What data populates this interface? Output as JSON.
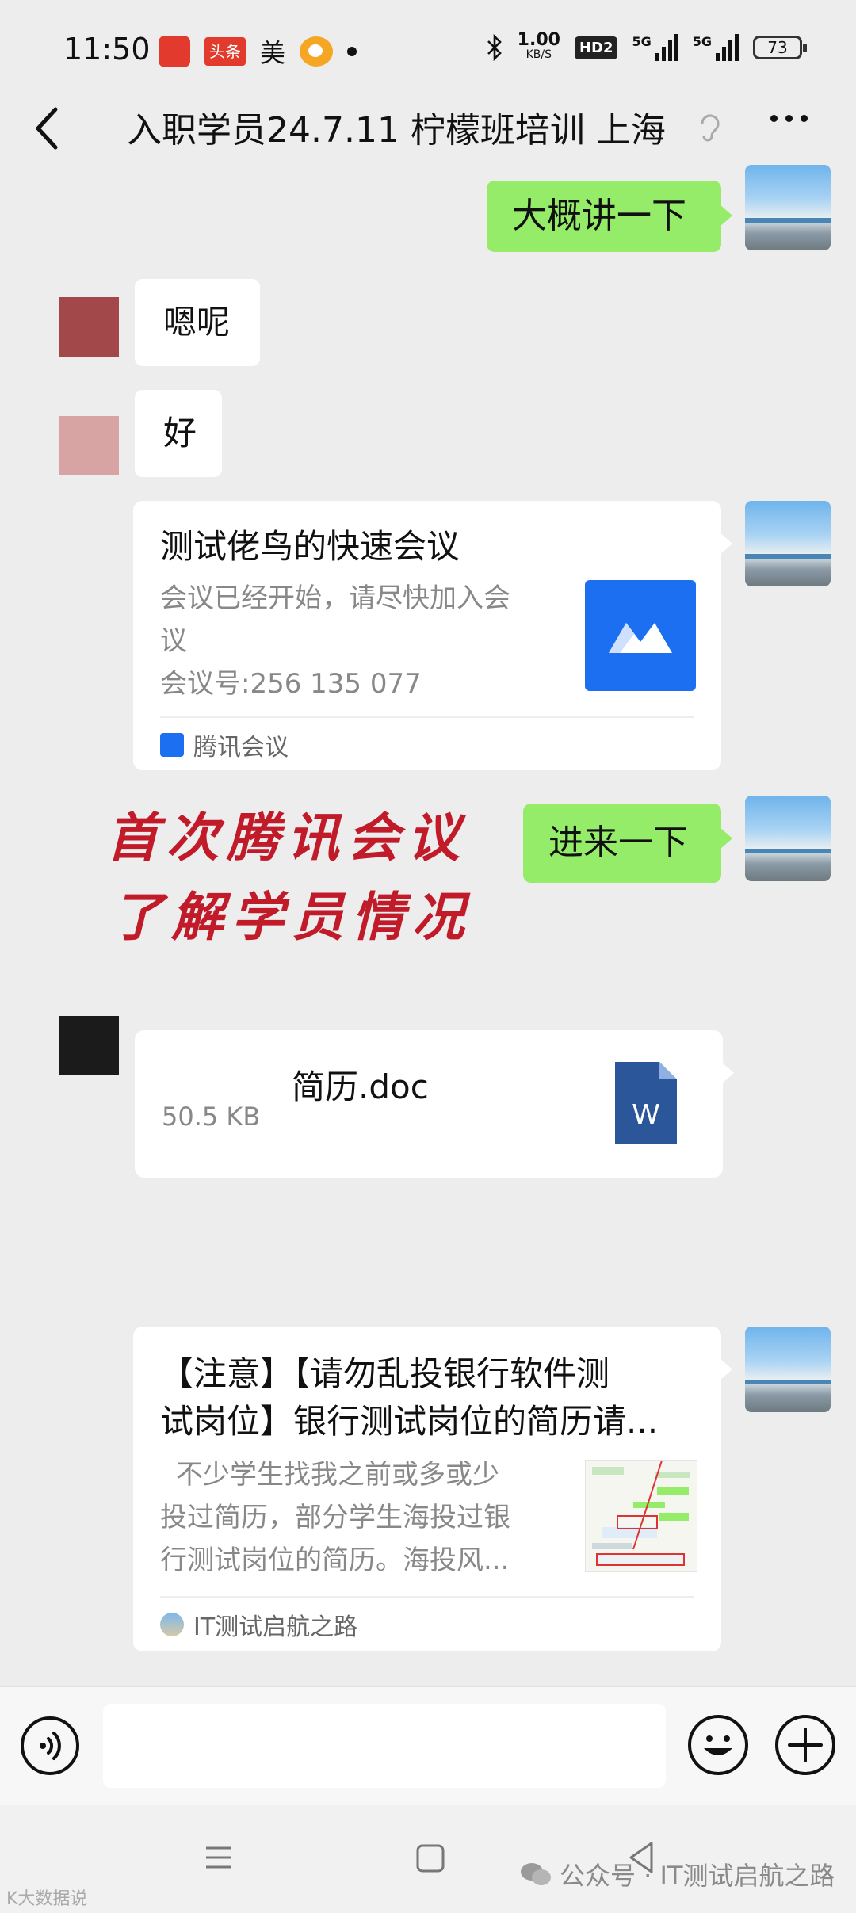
{
  "status_bar": {
    "time": "11:50",
    "app_text_1": "头条",
    "app_text_2": "美",
    "speed_value": "1.00",
    "speed_unit": "KB/S",
    "hd_label": "HD2",
    "sig1_label": "5G",
    "sig2_label": "5G",
    "battery": "73"
  },
  "header": {
    "title": "入职学员24.7.11 柠檬班培训 上海"
  },
  "messages": {
    "m1_text": "大概讲一下",
    "m2_text": "嗯呢",
    "m3_text": "好",
    "meeting_card": {
      "title": "测试佬鸟的快速会议",
      "desc_line1": "会议已经开始，请尽快加入会",
      "desc_line2": "议",
      "meeting_id": "会议号:256 135 077",
      "source": "腾讯会议"
    },
    "m5_text": "进来一下",
    "overlay_line1": "首次腾讯会议",
    "overlay_line2": "了解学员情况",
    "file_card": {
      "name": "简历.doc",
      "size": "50.5 KB",
      "icon_letter": "W"
    },
    "article_card": {
      "title_line1": "【注意】【请勿乱投银行软件测",
      "title_line2": "试岗位】银行测试岗位的简历请...",
      "desc_line1": "不少学生找我之前或多或少",
      "desc_line2": "投过简历，部分学生海投过银",
      "desc_line3": "行测试岗位的简历。海投风...",
      "source": "IT测试启航之路"
    }
  },
  "watermarks": {
    "wechat": "公众号 · IT测试启航之路",
    "corner": "K大数据说"
  },
  "colors": {
    "chat_bg": "#ededed",
    "green_bubble": "#95ec69",
    "overlay_red": "#c11b2a",
    "tencent_meeting_blue": "#1b6ff0",
    "word_blue": "#2b579a"
  }
}
